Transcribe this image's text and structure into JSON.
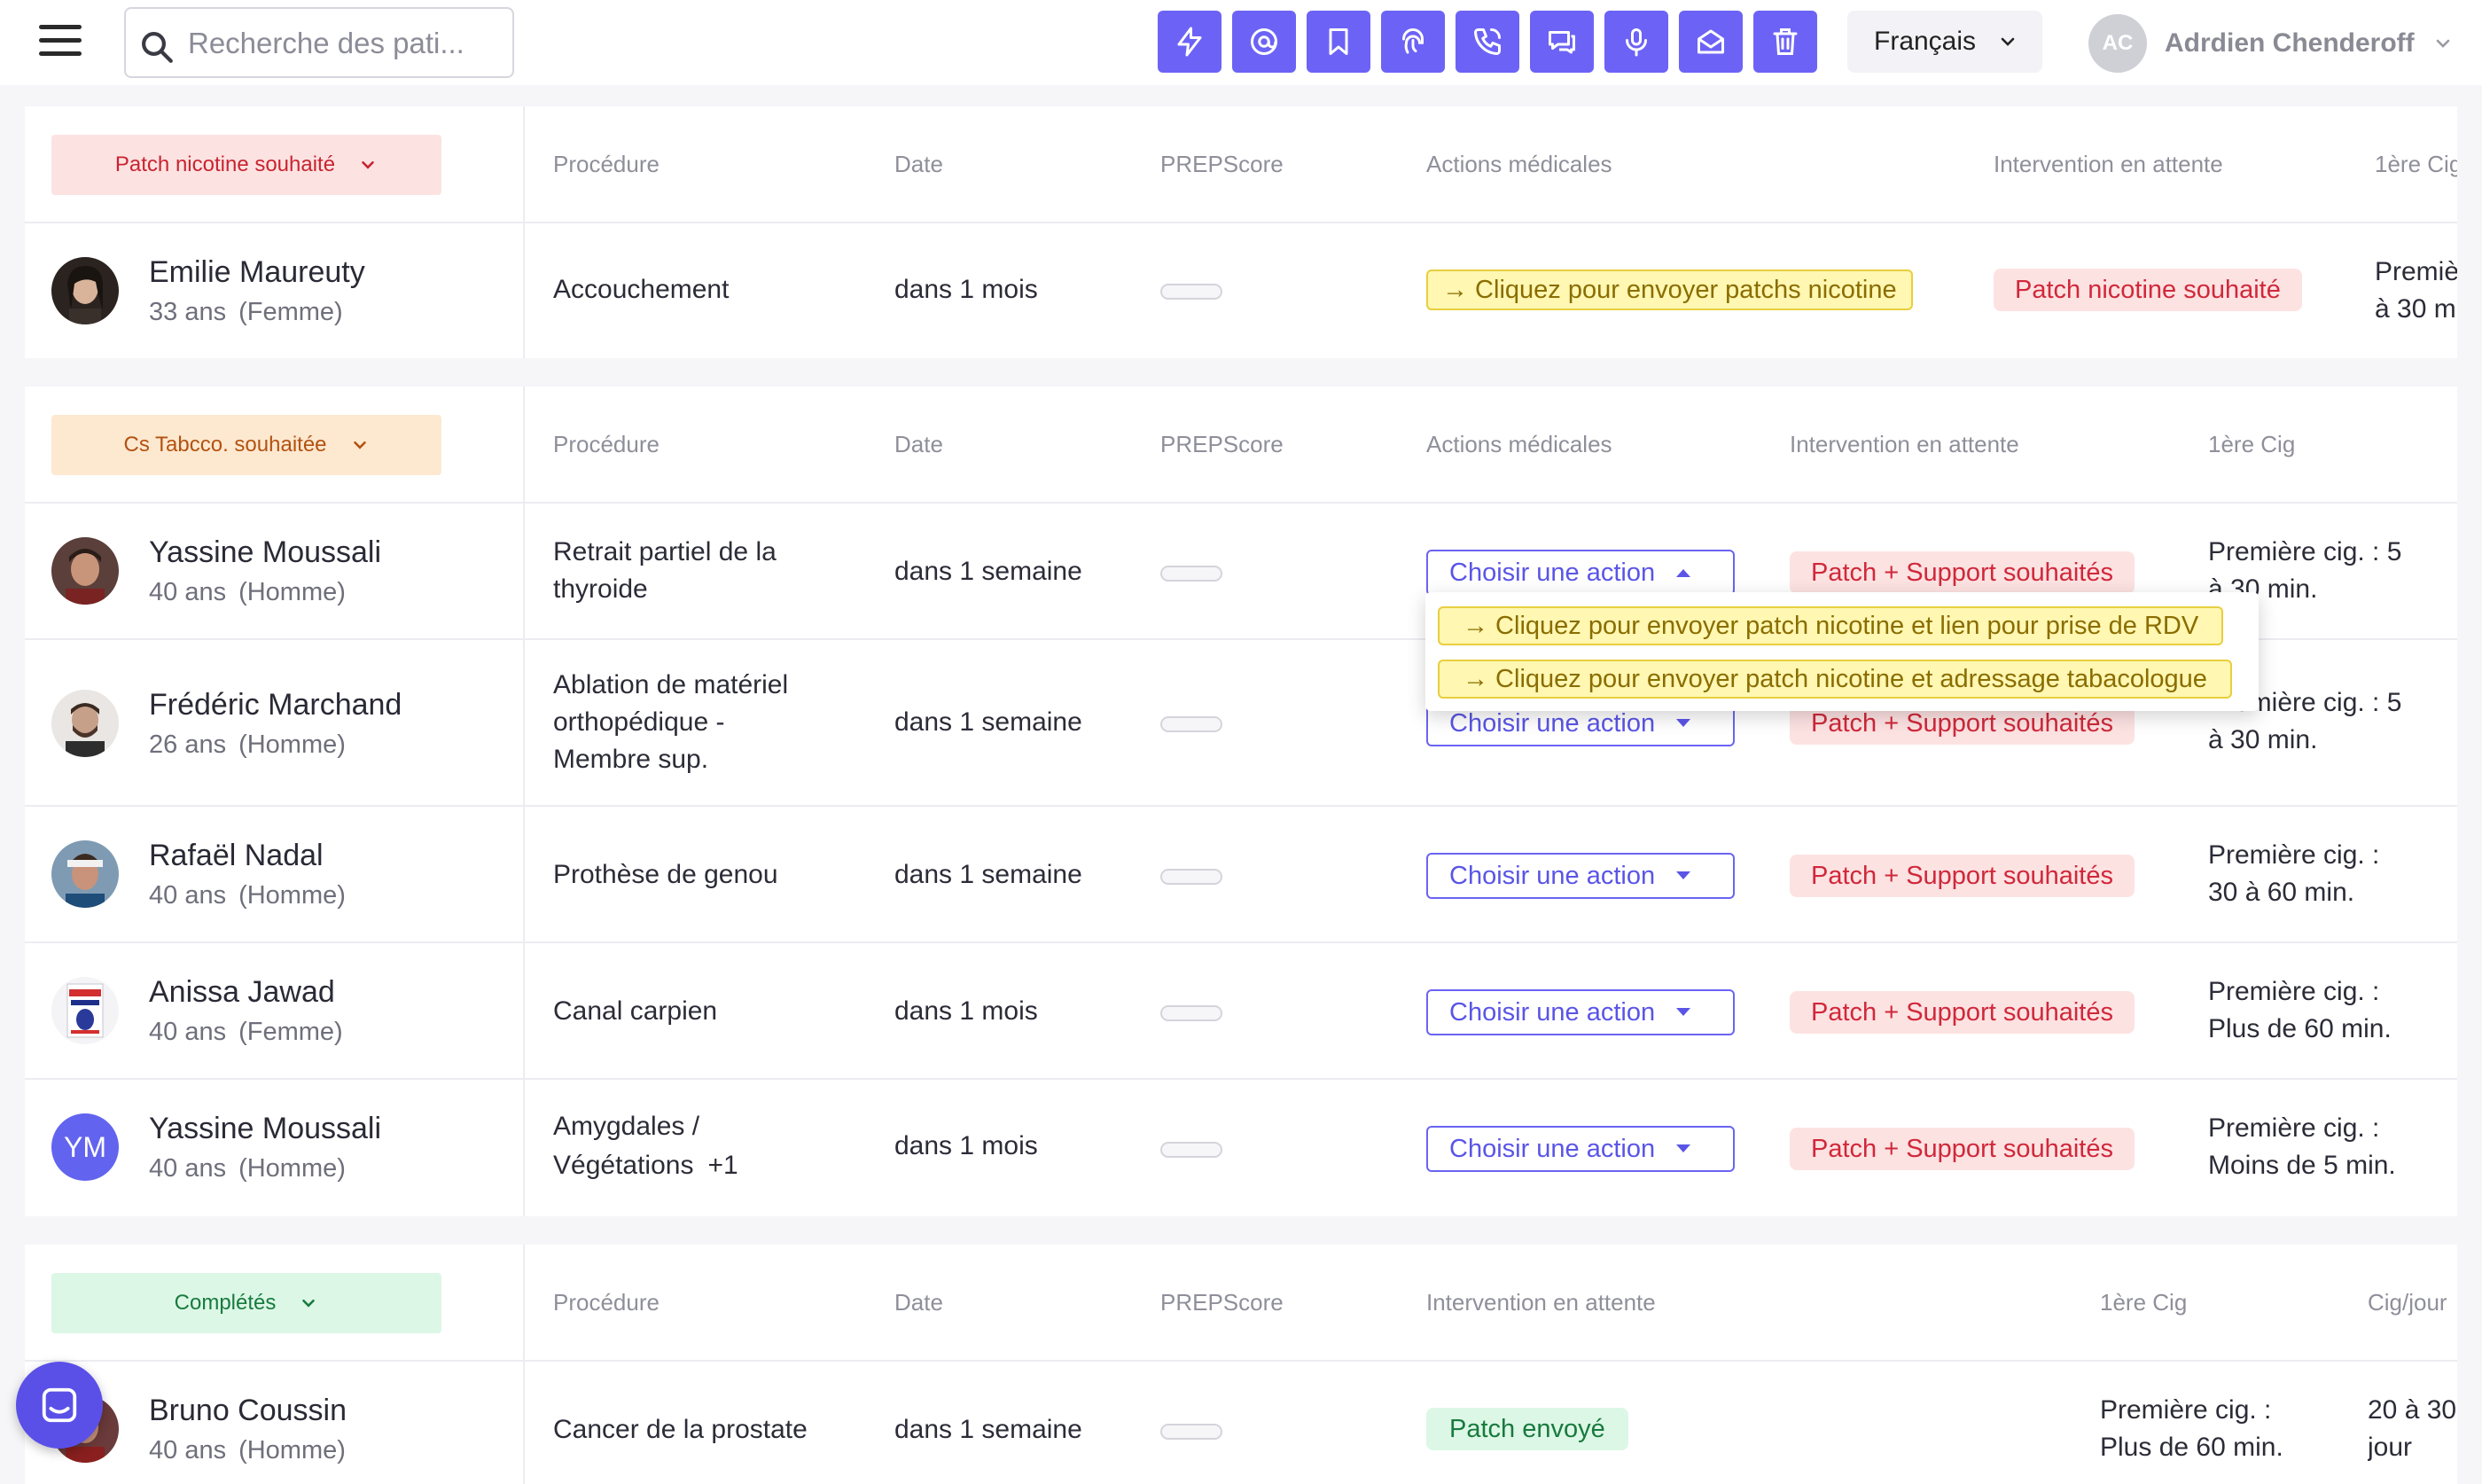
{
  "search": {
    "placeholder": "Recherche des pati..."
  },
  "toolbar": {
    "icons": [
      "bolt-icon",
      "at-icon",
      "bookmark-icon",
      "fingerprint-icon",
      "phone-call-icon",
      "chat-icon",
      "microphone-icon",
      "mail-icon",
      "trash-icon"
    ],
    "color": "#6c63f6"
  },
  "language": {
    "label": "Français"
  },
  "user": {
    "initials": "AC",
    "name": "Adrdien Chenderoff"
  },
  "sections": [
    {
      "status": "Patch nicotine souhaité",
      "columns": [
        "Procédure",
        "Date",
        "PREPScore",
        "Actions médicales",
        "Intervention en attente",
        "1ère Cig"
      ],
      "rows": [
        {
          "name": "Emilie Maureuty",
          "age": "33 ans",
          "sex": "(Femme)",
          "procedure": "Accouchement",
          "date": "dans 1 mois",
          "action": "→ Cliquez pour envoyer patchs nicotine",
          "intervention": "Patch nicotine souhaité",
          "first_cig_1": "Premiè",
          "first_cig_2": "à 30 m"
        }
      ]
    },
    {
      "status": "Cs Tabcco. souhaitée",
      "columns": [
        "Procédure",
        "Date",
        "PREPScore",
        "Actions médicales",
        "Intervention en attente",
        "1ère Cig"
      ],
      "rows": [
        {
          "name": "Yassine Moussali",
          "age": "40 ans",
          "sex": "(Homme)",
          "procedure_1": "Retrait partiel de la",
          "procedure_2": "thyroide",
          "date": "dans 1 semaine",
          "action": "Choisir une action",
          "intervention": "Patch + Support souhaités",
          "first_cig_1": "Première cig. : 5",
          "first_cig_2": "à 30 min."
        },
        {
          "name": "Frédéric Marchand",
          "age": "26 ans",
          "sex": "(Homme)",
          "procedure_1": "Ablation de matériel",
          "procedure_2": "orthopédique -",
          "procedure_3": "Membre sup.",
          "date": "dans 1 semaine",
          "action": "Choisir une action",
          "intervention": "Patch + Support souhaités",
          "first_cig_1": "Première cig. : 5",
          "first_cig_2": "à 30 min."
        },
        {
          "name": "Rafaël Nadal",
          "age": "40 ans",
          "sex": "(Homme)",
          "procedure": "Prothèse de genou",
          "date": "dans 1 semaine",
          "action": "Choisir une action",
          "intervention": "Patch + Support souhaités",
          "first_cig_1": "Première cig. :",
          "first_cig_2": "30 à 60 min."
        },
        {
          "name": "Anissa Jawad",
          "age": "40 ans",
          "sex": "(Femme)",
          "procedure": "Canal carpien",
          "date": "dans 1 mois",
          "action": "Choisir une action",
          "intervention": "Patch + Support souhaités",
          "first_cig_1": "Première cig. :",
          "first_cig_2": "Plus de 60 min."
        },
        {
          "name": "Yassine Moussali",
          "initials": "YM",
          "age": "40 ans",
          "sex": "(Homme)",
          "procedure_1": "Amygdales /",
          "procedure_2": "Végétations",
          "procedure_extra": "+1",
          "date": "dans 1 mois",
          "action": "Choisir une action",
          "intervention": "Patch + Support souhaités",
          "first_cig_1": "Première cig. :",
          "first_cig_2": "Moins de 5 min."
        }
      ]
    },
    {
      "status": "Complétés",
      "columns": [
        "Procédure",
        "Date",
        "PREPScore",
        "Intervention en attente",
        "1ère Cig",
        "Cig/jour"
      ],
      "rows": [
        {
          "name": "Bruno Coussin",
          "age": "40 ans",
          "sex": "(Homme)",
          "procedure": "Cancer de la prostate",
          "date": "dans 1 semaine",
          "intervention": "Patch envoyé",
          "first_cig_1": "Première cig. :",
          "first_cig_2": "Plus de 60 min.",
          "cig_day_1": "20 à 30",
          "cig_day_2": "jour"
        }
      ]
    }
  ],
  "dropdown": {
    "options": [
      "→ Cliquez pour envoyer patch nicotine et lien pour prise de RDV",
      "→ Cliquez pour envoyer patch nicotine et adressage tabacologue"
    ]
  },
  "colors": {
    "accent": "#6c63f6",
    "danger": "#d0283a",
    "warning": "#fff7b2",
    "success": "#dcf7e6"
  }
}
